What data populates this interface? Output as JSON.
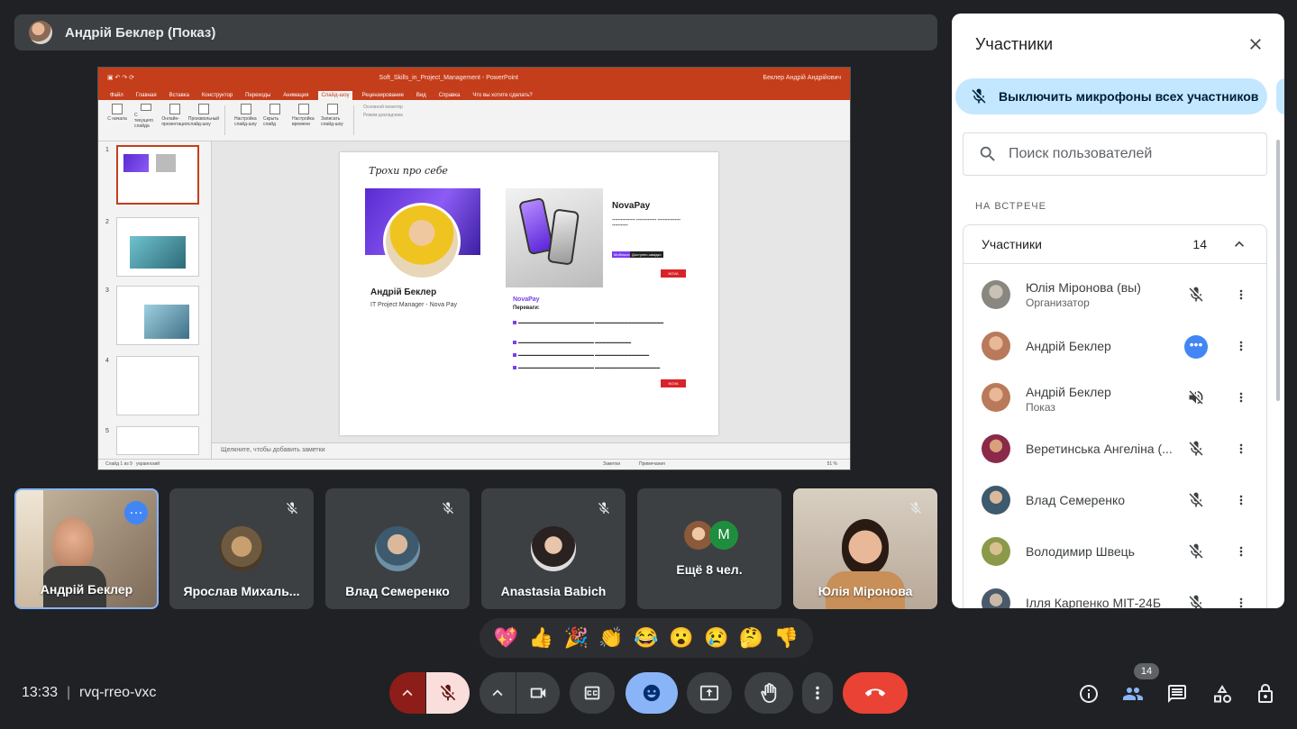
{
  "presenter_bar": {
    "name": "Андрій Беклер (Показ)"
  },
  "shared_screen": {
    "ppt_title": "Soft_Skills_in_Project_Management - PowerPoint",
    "ppt_user": "Беклер Андрій Андрійович",
    "tabs": [
      "Файл",
      "Главная",
      "Вставка",
      "Конструктор",
      "Переходы",
      "Анимация",
      "Слайд-шоу",
      "Рецензирование",
      "Вид",
      "Справка",
      "Что вы хотите сделать?"
    ],
    "active_tab": "Слайд-шоу",
    "ribbon_buttons": [
      "С начала",
      "С текущего слайда",
      "Онлайн-презентация",
      "Произвольный слайд-шоу",
      "Настройка слайд-шоу",
      "Скрыть слайд",
      "Настройка времени",
      "Записать слайд-шоу"
    ],
    "monitor_label": "Основной монитор",
    "presenter_mode": "Режим докладчика",
    "slide": {
      "title": "Трохи про себе",
      "person_name": "Андрій Беклер",
      "person_role": "IT Project Manager - Nova Pay",
      "brand": "NovaPay",
      "brand2": "NovaPay",
      "advantages": "Переваги:",
      "tag1": "Мобільно",
      "tag2": "Доступно швидко",
      "logo": "NOVA"
    },
    "notes_placeholder": "Щелкните, чтобы добавить заметки",
    "status_left": "Слайд 1 из 9",
    "status_lang": "украинский",
    "status_notes": "Заметки",
    "status_comments": "Примечания",
    "status_zoom": "51 %"
  },
  "tiles": [
    {
      "name": "Андрій Беклер"
    },
    {
      "name": "Ярослав Михаль..."
    },
    {
      "name": "Влад Семеренко"
    },
    {
      "name": "Anastasia Babich"
    },
    {
      "name": "Ещё 8 чел.",
      "initial": "M"
    },
    {
      "name": "Юлія Міронова"
    }
  ],
  "reactions": [
    "💖",
    "👍",
    "🎉",
    "👏",
    "😂",
    "😮",
    "😢",
    "🤔",
    "👎"
  ],
  "bottom": {
    "time": "13:33",
    "separator": "|",
    "meeting_code": "rvq-rreo-vxc",
    "participants_badge": "14"
  },
  "panel": {
    "title": "Участники",
    "mute_all": "Выключить микрофоны всех участников",
    "search_placeholder": "Поиск пользователей",
    "section": "НА ВСТРЕЧЕ",
    "group_label": "Участники",
    "group_count": "14",
    "participants": [
      {
        "name": "Юлія Міронова (вы)",
        "sub": "Организатор"
      },
      {
        "name": "Андрій Беклер",
        "sub": ""
      },
      {
        "name": "Андрій Беклер",
        "sub": "Показ"
      },
      {
        "name": "Веретинська Ангеліна (...",
        "sub": ""
      },
      {
        "name": "Влад Семеренко",
        "sub": ""
      },
      {
        "name": "Володимир Швець",
        "sub": ""
      },
      {
        "name": "Ілля Карпенко МІТ-24Б",
        "sub": ""
      }
    ]
  },
  "colors": {
    "accent": "#8ab4f8",
    "end_call": "#ea4335",
    "mic_off": "#f9dedc",
    "ppt": "#c43e1c",
    "mute_all_bg": "#c2e7ff"
  }
}
